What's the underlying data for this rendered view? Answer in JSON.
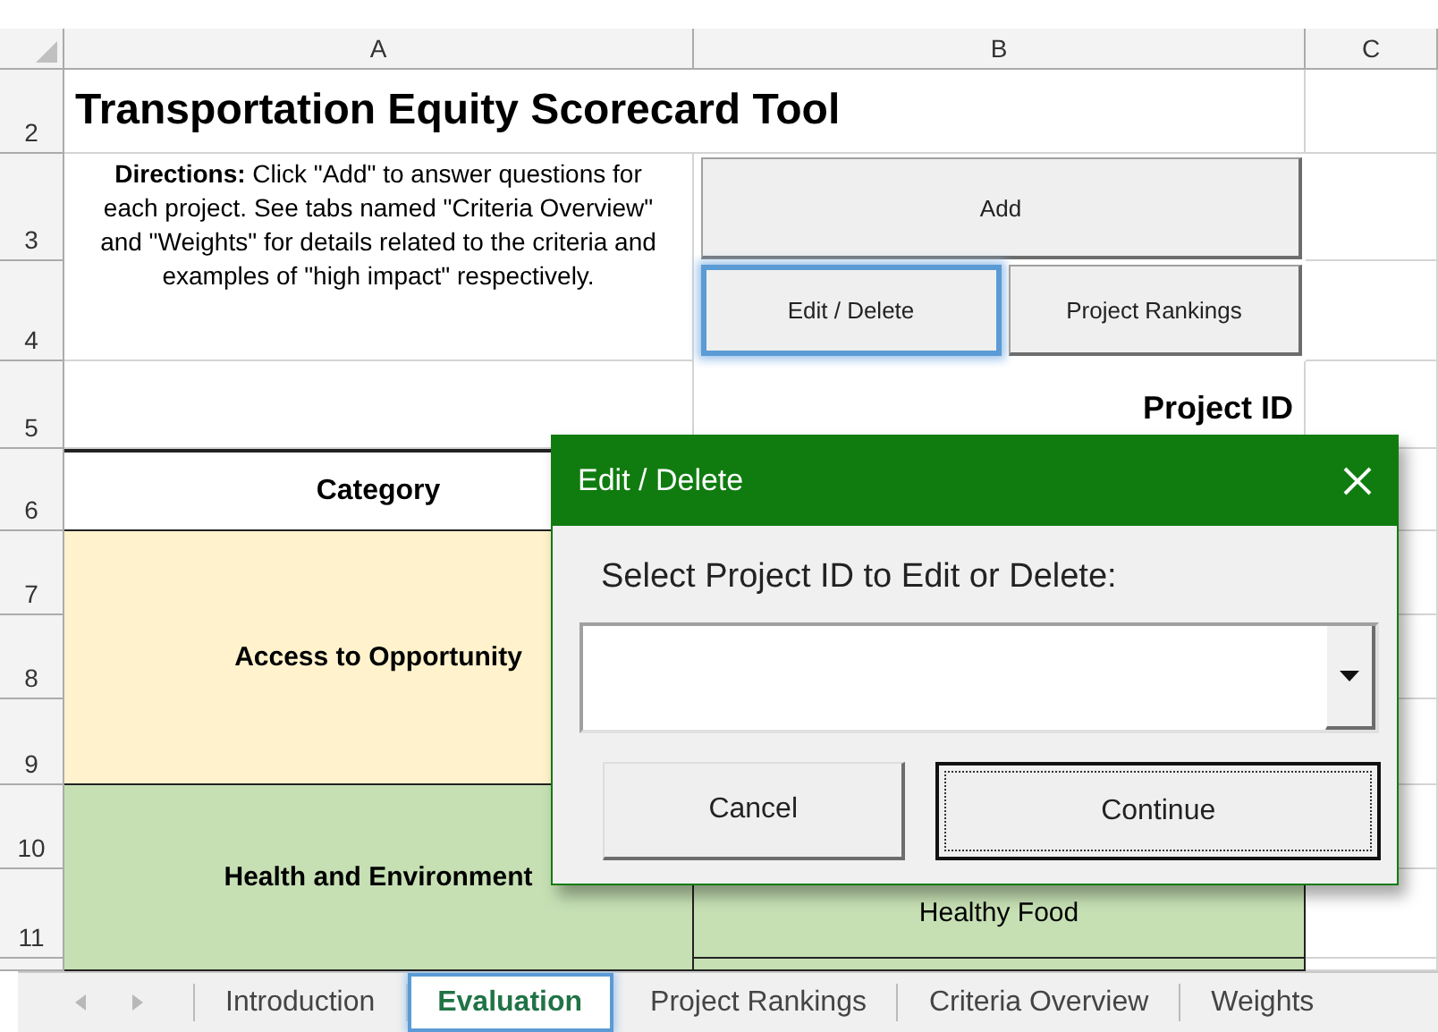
{
  "column_headers": [
    "A",
    "B",
    "C"
  ],
  "row_numbers": [
    "2",
    "3",
    "4",
    "5",
    "6",
    "7",
    "8",
    "9",
    "10",
    "11"
  ],
  "title": "Transportation Equity Scorecard Tool",
  "directions": "**Directions:** Click \"Add\" to answer questions for each project. See tabs named \"Criteria Overview\" and \"Weights\" for details related to the criteria and examples of \"high impact\" respectively.",
  "buttons": [
    {
      "label": "Add",
      "focused": false
    },
    {
      "label": "Edit / Delete",
      "focused": true
    },
    {
      "label": "Project Rankings",
      "focused": false
    }
  ],
  "project_id_label": "Project ID",
  "category_header": "Category",
  "categories": [
    {
      "label": "Access to Opportunity",
      "color": "#fff2cc"
    },
    {
      "label": "Health and Environment",
      "color": "#c6e0b4"
    }
  ],
  "criteria": [
    {
      "label": "Healthy Food"
    }
  ],
  "dialog": {
    "title": "Edit / Delete",
    "prompt": "Select Project ID to Edit or Delete:",
    "buttons": [
      {
        "label": "Cancel",
        "default": false
      },
      {
        "label": "Continue",
        "default": true
      }
    ]
  },
  "sheet_tabs": [
    {
      "label": "Introduction",
      "selected": false
    },
    {
      "label": "Evaluation",
      "selected": true
    },
    {
      "label": "Project Rankings",
      "selected": false
    },
    {
      "label": "Criteria Overview",
      "selected": false
    },
    {
      "label": "Weights",
      "selected": false
    }
  ]
}
